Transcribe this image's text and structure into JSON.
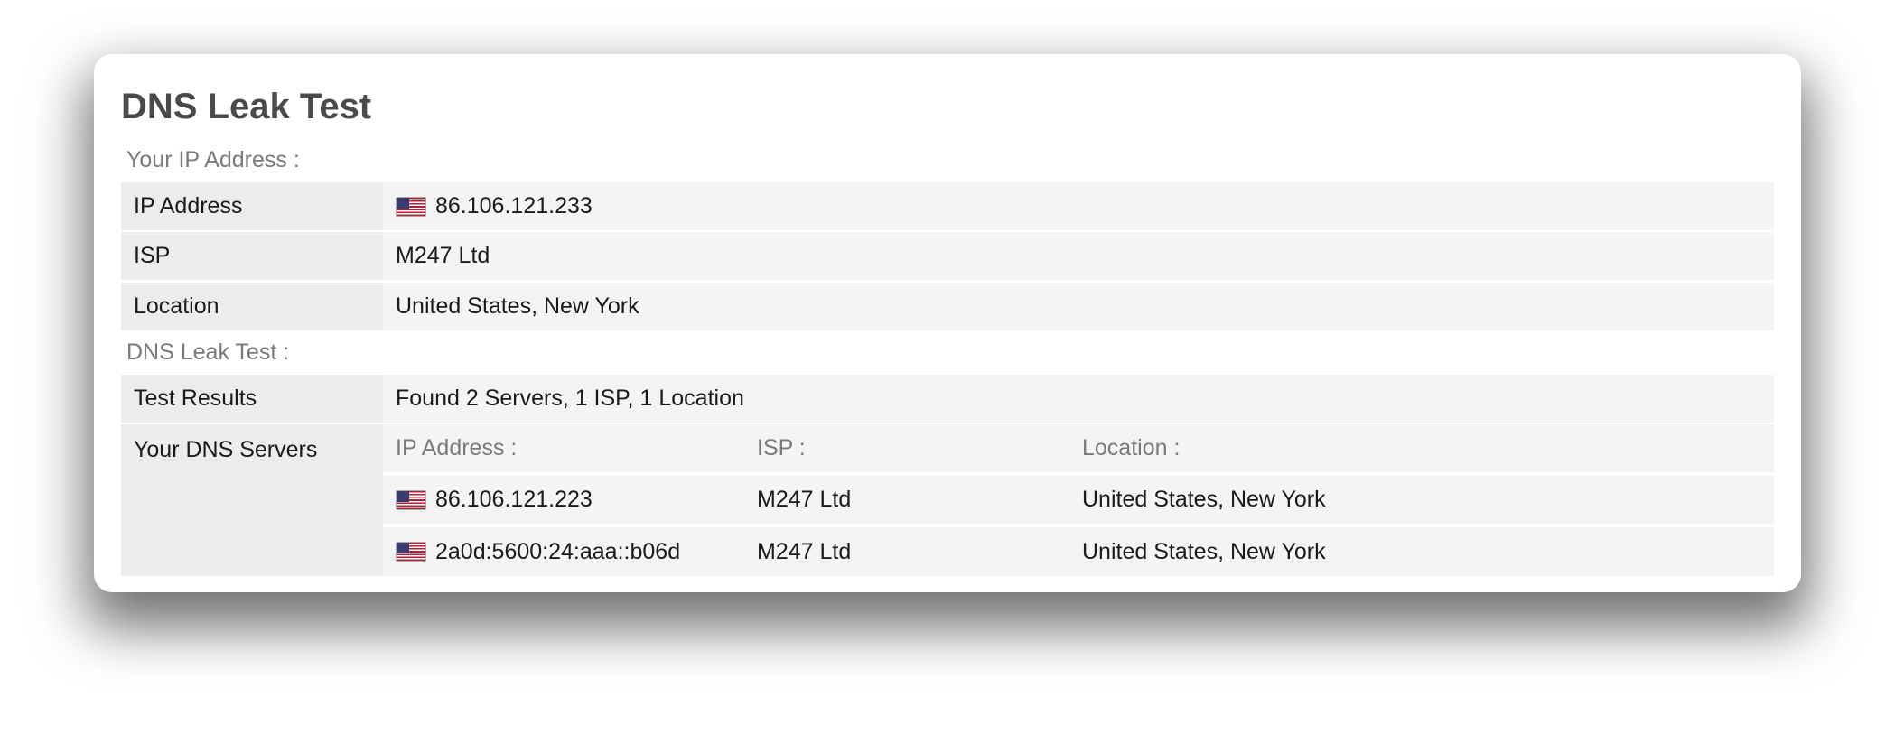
{
  "title": "DNS Leak Test",
  "ip_section": {
    "heading": "Your IP Address :",
    "rows": {
      "ip_label": "IP Address",
      "ip_value": "86.106.121.233",
      "ip_flag": "us",
      "isp_label": "ISP",
      "isp_value": "M247 Ltd",
      "location_label": "Location",
      "location_value": "United States, New York"
    }
  },
  "dns_section": {
    "heading": "DNS Leak Test :",
    "results_label": "Test Results",
    "results_value": "Found 2 Servers, 1 ISP, 1 Location",
    "servers_label": "Your DNS Servers",
    "columns": {
      "ip": "IP Address :",
      "isp": "ISP :",
      "location": "Location :"
    },
    "servers": [
      {
        "flag": "us",
        "ip": "86.106.121.223",
        "isp": "M247 Ltd",
        "location": "United States, New York"
      },
      {
        "flag": "us",
        "ip": "2a0d:5600:24:aaa::b06d",
        "isp": "M247 Ltd",
        "location": "United States, New York"
      }
    ]
  }
}
